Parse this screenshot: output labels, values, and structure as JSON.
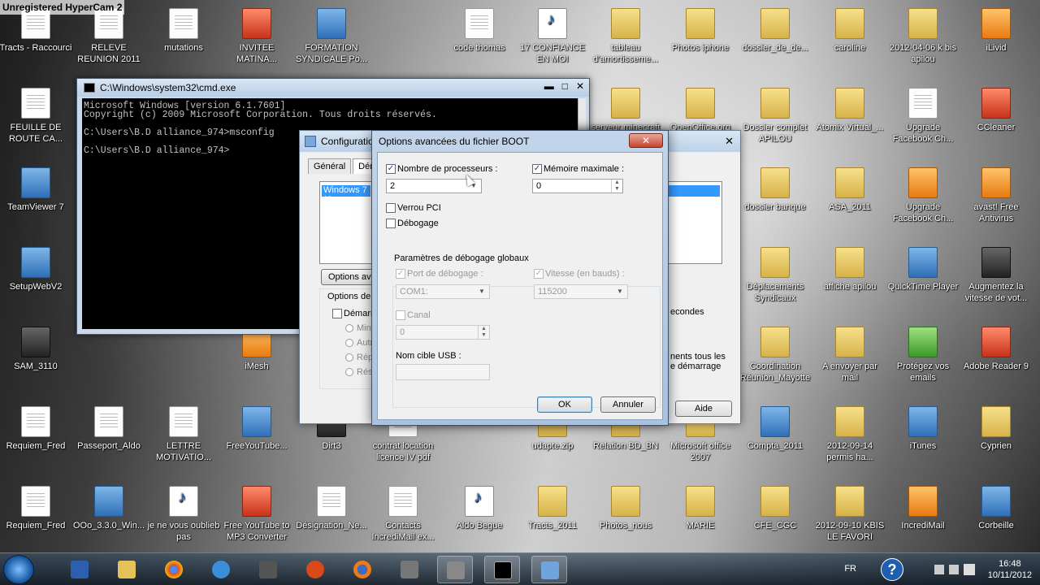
{
  "watermark": "Unregistered HyperCam 2",
  "desktop_icons": [
    {
      "label": "Tracts - Raccourci",
      "kind": "doc"
    },
    {
      "label": "RELEVE REUNION 2011",
      "kind": "doc"
    },
    {
      "label": "mutations",
      "kind": "doc"
    },
    {
      "label": "INVITEE MATINA...",
      "kind": "red"
    },
    {
      "label": "FORMATION SYNDICALE Po...",
      "kind": "app"
    },
    {
      "label": "code thomas",
      "kind": "doc"
    },
    {
      "label": "17 CONFIANCE EN MOI",
      "kind": "media"
    },
    {
      "label": "tableau d'amortisseme...",
      "kind": "folder"
    },
    {
      "label": "Photos iphone",
      "kind": "folder"
    },
    {
      "label": "dossier_de_de...",
      "kind": "folder"
    },
    {
      "label": "caroline",
      "kind": "folder"
    },
    {
      "label": "2012-04-06 k bis apilou",
      "kind": "folder"
    },
    {
      "label": "iLivid",
      "kind": "orange"
    },
    {
      "label": "FEUILLE DE ROUTE CA...",
      "kind": "doc"
    },
    {
      "label": "serveur minecraft",
      "kind": "folder"
    },
    {
      "label": "OpenOffice.org",
      "kind": "folder"
    },
    {
      "label": "Dossier complet APILOU",
      "kind": "folder"
    },
    {
      "label": "Atomix Virtual_...",
      "kind": "folder"
    },
    {
      "label": "Upgrade Facebook Ch...",
      "kind": "doc"
    },
    {
      "label": "CCleaner",
      "kind": "red"
    },
    {
      "label": "TeamViewer 7",
      "kind": "app"
    },
    {
      "label": "dossier banque",
      "kind": "folder"
    },
    {
      "label": "ASA_2011",
      "kind": "folder"
    },
    {
      "label": "Upgrade Facebook Ch...",
      "kind": "orange"
    },
    {
      "label": "avast! Free Antivirus",
      "kind": "orange"
    },
    {
      "label": "SetupWebV2",
      "kind": "app"
    },
    {
      "label": "Déplacements Syndicaux",
      "kind": "folder"
    },
    {
      "label": "affiche apilou",
      "kind": "folder"
    },
    {
      "label": "QuickTime Player",
      "kind": "app"
    },
    {
      "label": "Augmentez la vitesse de vot...",
      "kind": "dark"
    },
    {
      "label": "SAM_3110",
      "kind": "dark"
    },
    {
      "label": "iMesh",
      "kind": "orange"
    },
    {
      "label": "Coordination Réunion_Mayotte",
      "kind": "folder"
    },
    {
      "label": "A envoyer par mail",
      "kind": "folder"
    },
    {
      "label": "Protégez vos emails",
      "kind": "green"
    },
    {
      "label": "Adobe Reader 9",
      "kind": "red"
    },
    {
      "label": "Requiem_Fred",
      "kind": "doc"
    },
    {
      "label": "Passeport_Aldo",
      "kind": "doc"
    },
    {
      "label": "LETTRE MOTIVATIO...",
      "kind": "doc"
    },
    {
      "label": "FreeYouTube...",
      "kind": "app"
    },
    {
      "label": "Dirt3",
      "kind": "dark"
    },
    {
      "label": "contrat location licence IV pdf",
      "kind": "doc"
    },
    {
      "label": "udapte.zip",
      "kind": "folder"
    },
    {
      "label": "Relation BD_BN",
      "kind": "folder"
    },
    {
      "label": "Microsoft office 2007",
      "kind": "folder"
    },
    {
      "label": "Compta_2011",
      "kind": "app"
    },
    {
      "label": "2012-09-14 permis ha...",
      "kind": "folder"
    },
    {
      "label": "iTunes",
      "kind": "app"
    },
    {
      "label": "Cyprien",
      "kind": "folder"
    },
    {
      "label": "Requiem_Fred",
      "kind": "doc"
    },
    {
      "label": "OOo_3.3.0_Win...",
      "kind": "app"
    },
    {
      "label": "je ne vous oublieb pas",
      "kind": "media"
    },
    {
      "label": "Free YouTube to MP3 Converter",
      "kind": "red"
    },
    {
      "label": "Désignation_Ne...",
      "kind": "doc"
    },
    {
      "label": "Contacts IncrediMail ex...",
      "kind": "doc"
    },
    {
      "label": "Aldo Begue",
      "kind": "media"
    },
    {
      "label": "Tracts_2011",
      "kind": "folder"
    },
    {
      "label": "Photos_nous",
      "kind": "folder"
    },
    {
      "label": "MARIE",
      "kind": "folder"
    },
    {
      "label": "CFE_CGC",
      "kind": "folder"
    },
    {
      "label": "2012-09-10 KBIS LE FAVORI",
      "kind": "folder"
    },
    {
      "label": "IncrediMail",
      "kind": "orange"
    },
    {
      "label": "Corbeille",
      "kind": "app"
    }
  ],
  "cmd": {
    "title": "C:\\Windows\\system32\\cmd.exe",
    "lines": "Microsoft Windows [version 6.1.7601]\nCopyright (c) 2009 Microsoft Corporation. Tous droits réservés.\n\nC:\\Users\\B.D alliance_974>msconfig\n\nC:\\Users\\B.D alliance_974>",
    "buttons": [
      "▬",
      "□",
      "✕"
    ]
  },
  "msconfig": {
    "title": "Configuratio",
    "close": "✕",
    "tabs": [
      "Général",
      "Déma"
    ],
    "list_item": "Windows 7 (C",
    "options_btn": "Options ava",
    "options_group": "Options de d",
    "safe_boot": "Démarr",
    "radios": [
      "Minim",
      "Autr",
      "Répa",
      "Rése"
    ],
    "right_text1": "econdes",
    "right_text2": "nents tous les",
    "right_text3": "e démarrage",
    "help_btn": "Aide"
  },
  "boot": {
    "title": "Options avancées du fichier BOOT",
    "close": "✕",
    "num_proc_label": "Nombre de processeurs :",
    "num_proc_value": "2",
    "num_proc_checked": true,
    "max_mem_label": "Mémoire maximale :",
    "max_mem_value": "0",
    "max_mem_checked": true,
    "pci_lock": "Verrou PCI",
    "debug": "Débogage",
    "global_debug_title": "Paramètres de débogage globaux",
    "debug_port_label": "Port de débogage :",
    "debug_port_value": "COM1:",
    "baud_label": "Vitesse (en bauds) :",
    "baud_value": "115200",
    "channel_label": "Canal",
    "channel_value": "0",
    "usb_target_label": "Nom cible USB :",
    "ok": "OK",
    "cancel": "Annuler"
  },
  "taskbar": {
    "lang": "FR",
    "time": "16:48",
    "date": "10/11/2012"
  },
  "colors": {
    "accent": "#3399ff",
    "cmd_bg": "#000000",
    "cmd_fg": "#c0c0c0"
  }
}
